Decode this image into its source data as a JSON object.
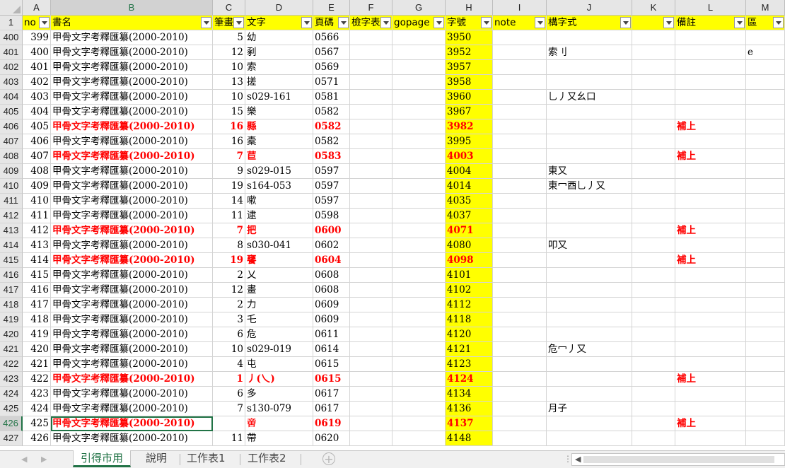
{
  "columns": [
    "A",
    "B",
    "C",
    "D",
    "E",
    "F",
    "G",
    "H",
    "I",
    "J",
    "K",
    "L",
    "M"
  ],
  "corner_header": "",
  "header_row_number": "1",
  "headers": [
    "no",
    "書名",
    "筆畫",
    "文字",
    "頁碼",
    "檢字表",
    "gopage",
    "字號",
    "note",
    "構字式",
    "",
    "備註",
    "區"
  ],
  "rows": [
    {
      "r": "400",
      "no": "399",
      "book": "甲骨文字考釋匯纂(2000-2010)",
      "strokes": "5",
      "char": "幼",
      "page": "0566",
      "num": "3950",
      "form": "",
      "remark": "",
      "m": "",
      "red": false
    },
    {
      "r": "401",
      "no": "400",
      "book": "甲骨文字考釋匯纂(2000-2010)",
      "strokes": "12",
      "char": "剢",
      "page": "0567",
      "num": "3952",
      "form": "索刂",
      "remark": "",
      "m": "e",
      "red": false
    },
    {
      "r": "402",
      "no": "401",
      "book": "甲骨文字考釋匯纂(2000-2010)",
      "strokes": "10",
      "char": "索",
      "page": "0569",
      "num": "3957",
      "form": "",
      "remark": "",
      "m": "",
      "red": false
    },
    {
      "r": "403",
      "no": "402",
      "book": "甲骨文字考釋匯纂(2000-2010)",
      "strokes": "13",
      "char": "搓",
      "page": "0571",
      "num": "3958",
      "form": "",
      "remark": "",
      "m": "",
      "red": false
    },
    {
      "r": "404",
      "no": "403",
      "book": "甲骨文字考釋匯纂(2000-2010)",
      "strokes": "10",
      "char": "s029-161",
      "page": "0581",
      "num": "3960",
      "form": "乚丿又幺口",
      "remark": "",
      "m": "",
      "red": false
    },
    {
      "r": "405",
      "no": "404",
      "book": "甲骨文字考釋匯纂(2000-2010)",
      "strokes": "15",
      "char": "樂",
      "page": "0582",
      "num": "3967",
      "form": "",
      "remark": "",
      "m": "",
      "red": false
    },
    {
      "r": "406",
      "no": "405",
      "book": "甲骨文字考釋匯纂(2000-2010)",
      "strokes": "16",
      "char": "縣",
      "page": "0582",
      "num": "3982",
      "form": "",
      "remark": "補上",
      "m": "",
      "red": true
    },
    {
      "r": "407",
      "no": "406",
      "book": "甲骨文字考釋匯纂(2000-2010)",
      "strokes": "16",
      "char": "橐",
      "page": "0582",
      "num": "3995",
      "form": "",
      "remark": "",
      "m": "",
      "red": false
    },
    {
      "r": "408",
      "no": "407",
      "book": "甲骨文字考釋匯纂(2000-2010)",
      "strokes": "7",
      "char": "苣",
      "page": "0583",
      "num": "4003",
      "form": "",
      "remark": "補上",
      "m": "",
      "red": true
    },
    {
      "r": "409",
      "no": "408",
      "book": "甲骨文字考釋匯纂(2000-2010)",
      "strokes": "9",
      "char": "s029-015",
      "page": "0597",
      "num": "4004",
      "form": "東又",
      "remark": "",
      "m": "",
      "red": false
    },
    {
      "r": "410",
      "no": "409",
      "book": "甲骨文字考釋匯纂(2000-2010)",
      "strokes": "19",
      "char": "s164-053",
      "page": "0597",
      "num": "4014",
      "form": "東冖酉乚丿又",
      "remark": "",
      "m": "",
      "red": false
    },
    {
      "r": "411",
      "no": "410",
      "book": "甲骨文字考釋匯纂(2000-2010)",
      "strokes": "14",
      "char": "嗽",
      "page": "0597",
      "num": "4035",
      "form": "",
      "remark": "",
      "m": "",
      "red": false
    },
    {
      "r": "412",
      "no": "411",
      "book": "甲骨文字考釋匯纂(2000-2010)",
      "strokes": "11",
      "char": "逮",
      "page": "0598",
      "num": "4037",
      "form": "",
      "remark": "",
      "m": "",
      "red": false
    },
    {
      "r": "413",
      "no": "412",
      "book": "甲骨文字考釋匯纂(2000-2010)",
      "strokes": "7",
      "char": "把",
      "page": "0600",
      "num": "4071",
      "form": "",
      "remark": "補上",
      "m": "",
      "red": true
    },
    {
      "r": "414",
      "no": "413",
      "book": "甲骨文字考釋匯纂(2000-2010)",
      "strokes": "8",
      "char": "s030-041",
      "page": "0602",
      "num": "4080",
      "form": "叩又",
      "remark": "",
      "m": "",
      "red": false
    },
    {
      "r": "415",
      "no": "414",
      "book": "甲骨文字考釋匯纂(2000-2010)",
      "strokes": "19",
      "char": "饔",
      "page": "0604",
      "num": "4098",
      "form": "",
      "remark": "補上",
      "m": "",
      "red": true
    },
    {
      "r": "416",
      "no": "415",
      "book": "甲骨文字考釋匯纂(2000-2010)",
      "strokes": "2",
      "char": "乂",
      "page": "0608",
      "num": "4101",
      "form": "",
      "remark": "",
      "m": "",
      "red": false
    },
    {
      "r": "417",
      "no": "416",
      "book": "甲骨文字考釋匯纂(2000-2010)",
      "strokes": "12",
      "char": "畫",
      "page": "0608",
      "num": "4102",
      "form": "",
      "remark": "",
      "m": "",
      "red": false
    },
    {
      "r": "418",
      "no": "417",
      "book": "甲骨文字考釋匯纂(2000-2010)",
      "strokes": "2",
      "char": "力",
      "page": "0609",
      "num": "4112",
      "form": "",
      "remark": "",
      "m": "",
      "red": false
    },
    {
      "r": "419",
      "no": "418",
      "book": "甲骨文字考釋匯纂(2000-2010)",
      "strokes": "3",
      "char": "乇",
      "page": "0609",
      "num": "4118",
      "form": "",
      "remark": "",
      "m": "",
      "red": false
    },
    {
      "r": "420",
      "no": "419",
      "book": "甲骨文字考釋匯纂(2000-2010)",
      "strokes": "6",
      "char": "危",
      "page": "0611",
      "num": "4120",
      "form": "",
      "remark": "",
      "m": "",
      "red": false
    },
    {
      "r": "421",
      "no": "420",
      "book": "甲骨文字考釋匯纂(2000-2010)",
      "strokes": "10",
      "char": "s029-019",
      "page": "0614",
      "num": "4121",
      "form": "危冖丿又",
      "remark": "",
      "m": "",
      "red": false
    },
    {
      "r": "422",
      "no": "421",
      "book": "甲骨文字考釋匯纂(2000-2010)",
      "strokes": "4",
      "char": "屯",
      "page": "0615",
      "num": "4123",
      "form": "",
      "remark": "",
      "m": "",
      "red": false
    },
    {
      "r": "423",
      "no": "422",
      "book": "甲骨文字考釋匯纂(2000-2010)",
      "strokes": "1",
      "char": "丿(乀)",
      "page": "0615",
      "num": "4124",
      "form": "",
      "remark": "補上",
      "m": "",
      "red": true
    },
    {
      "r": "424",
      "no": "423",
      "book": "甲骨文字考釋匯纂(2000-2010)",
      "strokes": "6",
      "char": "多",
      "page": "0617",
      "num": "4134",
      "form": "",
      "remark": "",
      "m": "",
      "red": false
    },
    {
      "r": "425",
      "no": "424",
      "book": "甲骨文字考釋匯纂(2000-2010)",
      "strokes": "7",
      "char": "s130-079",
      "page": "0617",
      "num": "4136",
      "form": "月子",
      "remark": "",
      "m": "",
      "red": false
    },
    {
      "r": "426",
      "no": "425",
      "book": "甲骨文字考釋匯纂(2000-2010)",
      "strokes": "",
      "char": "𠶷",
      "page": "0619",
      "num": "4137",
      "form": "",
      "remark": "補上",
      "m": "",
      "red": true,
      "selected": true
    },
    {
      "r": "427",
      "no": "426",
      "book": "甲骨文字考釋匯纂(2000-2010)",
      "strokes": "11",
      "char": "帶",
      "page": "0620",
      "num": "4148",
      "form": "",
      "remark": "",
      "m": "",
      "red": false
    }
  ],
  "tabs": [
    "引得市用",
    "說明",
    "工作表1",
    "工作表2"
  ],
  "active_tab_index": 0,
  "colors": {
    "header_fill": "#ffff00",
    "highlight_text": "#ff0000",
    "excel_green": "#217346"
  }
}
